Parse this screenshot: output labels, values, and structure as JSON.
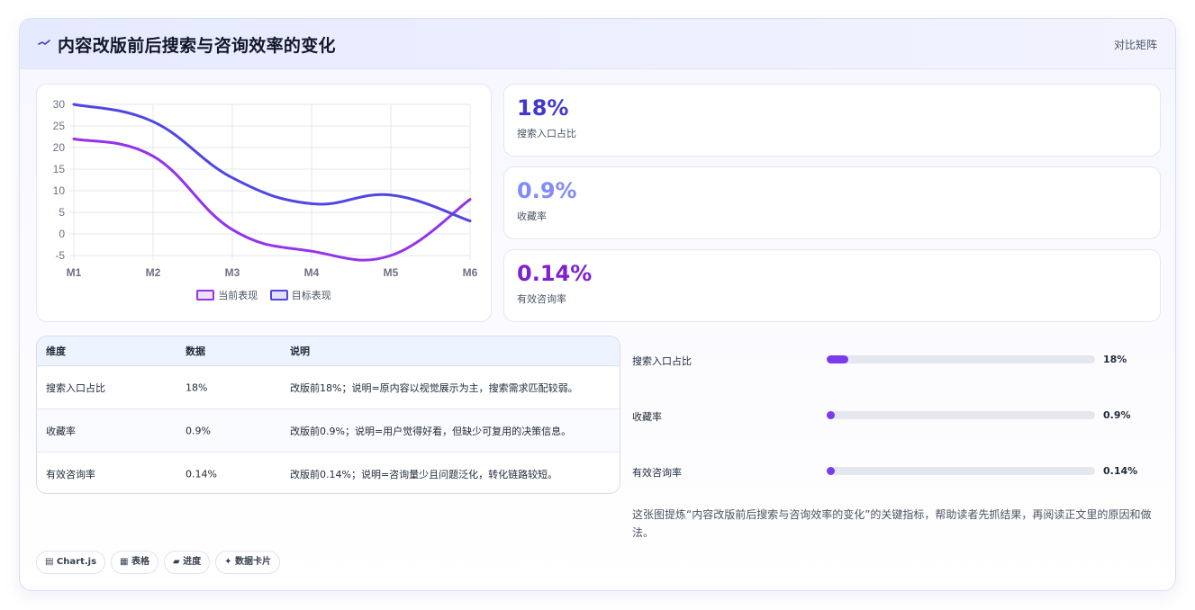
{
  "header": {
    "title": "内容改版前后搜索与咨询效率的变化",
    "tag": "对比矩阵"
  },
  "chart_data": {
    "type": "line",
    "categories": [
      "M1",
      "M2",
      "M3",
      "M4",
      "M5",
      "M6"
    ],
    "series": [
      {
        "name": "当前表现",
        "values": [
          22,
          18,
          1,
          -4,
          -5,
          8
        ],
        "color": "#9333ea"
      },
      {
        "name": "目标表现",
        "values": [
          30,
          26,
          13,
          7,
          9,
          3
        ],
        "color": "#4f46e5"
      }
    ],
    "yticks": [
      30,
      25,
      20,
      15,
      10,
      5,
      0,
      -5
    ],
    "ylim": [
      -5,
      30
    ],
    "grid": true,
    "legend": "bottom"
  },
  "stats": [
    {
      "value": "18%",
      "label": "搜索入口占比",
      "color": "#4338ca"
    },
    {
      "value": "0.9%",
      "label": "收藏率",
      "color": "#818cf8"
    },
    {
      "value": "0.14%",
      "label": "有效咨询率",
      "color": "#7e22ce"
    }
  ],
  "table": {
    "headers": [
      "维度",
      "数据",
      "说明"
    ],
    "rows": [
      [
        "搜索入口占比",
        "18%",
        "改版前18%；说明=原内容以视觉展示为主，搜索需求匹配较弱。"
      ],
      [
        "收藏率",
        "0.9%",
        "改版前0.9%；说明=用户觉得好看，但缺少可复用的决策信息。"
      ],
      [
        "有效咨询率",
        "0.14%",
        "改版前0.14%；说明=咨询量少且问题泛化，转化链路较短。"
      ]
    ]
  },
  "progress": [
    {
      "label": "搜索入口占比",
      "value": "18%",
      "fraction": 0.08
    },
    {
      "label": "收藏率",
      "value": "0.9%",
      "fraction": 0.03
    },
    {
      "label": "有效咨询率",
      "value": "0.14%",
      "fraction": 0.03
    }
  ],
  "note": "这张图提炼“内容改版前后搜索与咨询效率的变化”的关键指标，帮助读者先抓结果，再阅读正文里的原因和做法。",
  "chips": [
    "▤ Chart.js",
    "▦ 表格",
    "▰ 进度",
    "✦ 数据卡片"
  ]
}
